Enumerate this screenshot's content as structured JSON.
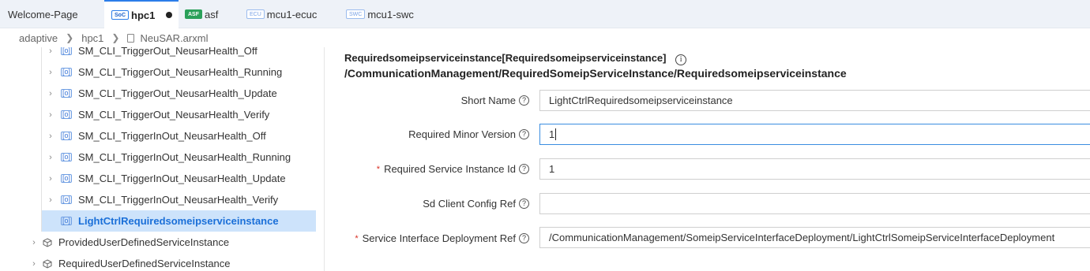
{
  "tabs": [
    {
      "label": "Welcome-Page"
    },
    {
      "badge": "SoC",
      "label": "hpc1",
      "active": true,
      "modified": true
    },
    {
      "badge": "ASF",
      "label": "asf"
    },
    {
      "badge": "ECU",
      "label": "mcu1-ecuc"
    },
    {
      "badge": "SWC",
      "label": "mcu1-swc"
    }
  ],
  "breadcrumb": [
    "adaptive",
    "hpc1",
    "NeuSAR.arxml"
  ],
  "tree": {
    "items": [
      {
        "label": "SM_CLI_TriggerOut_NeusarHealth_Off",
        "icon": "service-instance-icon"
      },
      {
        "label": "SM_CLI_TriggerOut_NeusarHealth_Running",
        "icon": "service-instance-icon"
      },
      {
        "label": "SM_CLI_TriggerOut_NeusarHealth_Update",
        "icon": "service-instance-icon"
      },
      {
        "label": "SM_CLI_TriggerOut_NeusarHealth_Verify",
        "icon": "service-instance-icon"
      },
      {
        "label": "SM_CLI_TriggerInOut_NeusarHealth_Off",
        "icon": "service-instance-icon"
      },
      {
        "label": "SM_CLI_TriggerInOut_NeusarHealth_Running",
        "icon": "service-instance-icon"
      },
      {
        "label": "SM_CLI_TriggerInOut_NeusarHealth_Update",
        "icon": "service-instance-icon"
      },
      {
        "label": "SM_CLI_TriggerInOut_NeusarHealth_Verify",
        "icon": "service-instance-icon"
      },
      {
        "label": "LightCtrlRequiredsomeipserviceinstance",
        "icon": "service-instance-icon",
        "selected": true
      },
      {
        "label": "ProvidedUserDefinedServiceInstance",
        "icon": "cube-icon"
      },
      {
        "label": "RequiredUserDefinedServiceInstance",
        "icon": "cube-icon"
      }
    ]
  },
  "form": {
    "title": "Requiredsomeipserviceinstance[Requiredsomeipserviceinstance]",
    "path": "/CommunicationManagement/RequiredSomeipServiceInstance/Requiredsomeipserviceinstance",
    "fields": [
      {
        "label": "Short Name",
        "required": false,
        "value": "LightCtrlRequiredsomeipserviceinstance"
      },
      {
        "label": "Required Minor Version",
        "required": false,
        "value": "1",
        "focused": true
      },
      {
        "label": "Required Service Instance Id",
        "required": true,
        "value": "1"
      },
      {
        "label": "Sd Client Config Ref",
        "required": false,
        "value": ""
      },
      {
        "label": "Service Interface Deployment Ref",
        "required": true,
        "value": "/CommunicationManagement/SomeipServiceInterfaceDeployment/LightCtrlSomeipServiceInterfaceDeployment"
      }
    ]
  },
  "colors": {
    "accent": "#2b7de9",
    "selection": "#cde3fb",
    "required": "#d93025"
  }
}
